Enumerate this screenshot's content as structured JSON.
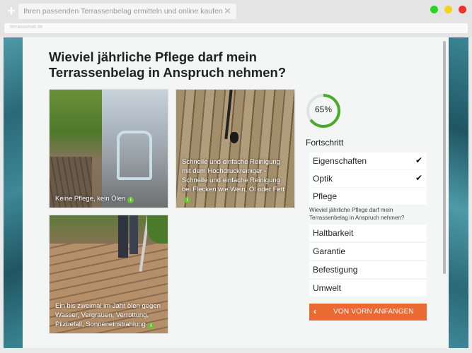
{
  "browser": {
    "tab_title": "Ihren passenden Terrassenbelag ermitteln und online kaufen",
    "url": "terrassomat.de",
    "new_tab": "+",
    "close": "✕"
  },
  "question": "Wieviel jährliche Pflege darf mein Terrassenbelag in Anspruch nehmen?",
  "options": [
    {
      "caption": "Keine Pflege, kein Ölen"
    },
    {
      "caption": "Schnelle und einfache Reinigung mit dem Hochdruckreiniger - Schnelle und einfache Reinigung bei Flecken wie Wein, Öl oder Fett"
    },
    {
      "caption": "Ein bis zweimal im Jahr ölen gegen Wasser, Vergrauen, Verrottung, Pilzbefall, Sonneneinstrahlung"
    }
  ],
  "info_icon": "i",
  "progress": {
    "percent": 65,
    "label": "65%",
    "color": "#4aaa2a"
  },
  "sidebar": {
    "heading": "Fortschritt",
    "steps": [
      {
        "label": "Eigenschaften",
        "check": "✔"
      },
      {
        "label": "Optik",
        "check": "✔"
      },
      {
        "label": "Pflege",
        "check": ""
      },
      {
        "label": "Haltbarkeit"
      },
      {
        "label": "Garantie"
      },
      {
        "label": "Befestigung"
      },
      {
        "label": "Umwelt"
      }
    ],
    "current_question": "Wieviel jährliche Pflege darf mein Terrassenbelag in Anspruch nehmen?"
  },
  "restart": {
    "arrow": "‹",
    "label": "VON VORN ANFANGEN",
    "color": "#ea6a31"
  }
}
